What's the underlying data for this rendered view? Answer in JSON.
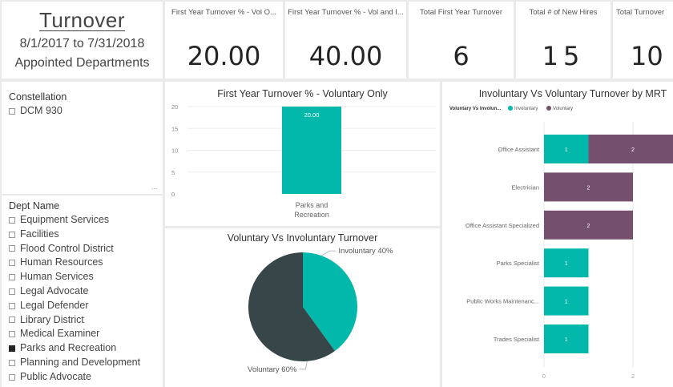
{
  "header": {
    "title": "Turnover",
    "date_range": "8/1/2017 to 7/31/2018",
    "scope": "Appointed Departments"
  },
  "cards": [
    {
      "label": "First Year Turnover % - Vol O...",
      "value": "20.00"
    },
    {
      "label": "First Year Turnover % - Vol and I...",
      "value": "40.00"
    },
    {
      "label": "Total First Year Turnover",
      "value": "6"
    },
    {
      "label": "Total # of New Hires",
      "value": "15"
    },
    {
      "label": "Total Turnover",
      "value": "10"
    }
  ],
  "constellation": {
    "title": "Constellation",
    "items": [
      {
        "label": "DCM 930",
        "checked": false
      }
    ],
    "more": "..."
  },
  "dept": {
    "title": "Dept Name",
    "items": [
      {
        "label": "Equipment Services",
        "checked": false
      },
      {
        "label": "Facilities",
        "checked": false
      },
      {
        "label": "Flood Control District",
        "checked": false
      },
      {
        "label": "Human Resources",
        "checked": false
      },
      {
        "label": "Human Services",
        "checked": false
      },
      {
        "label": "Legal Advocate",
        "checked": false
      },
      {
        "label": "Legal Defender",
        "checked": false
      },
      {
        "label": "Library District",
        "checked": false
      },
      {
        "label": "Medical Examiner",
        "checked": false
      },
      {
        "label": "Parks and Recreation",
        "checked": true
      },
      {
        "label": "Planning and Development",
        "checked": false
      },
      {
        "label": "Public Advocate",
        "checked": false
      }
    ]
  },
  "colors": {
    "teal": "#01b8aa",
    "plum": "#744f6e",
    "dark": "#374649"
  },
  "chart_data": [
    {
      "type": "bar",
      "title": "First Year Turnover % - Voluntary Only",
      "categories": [
        "Parks and Recreation"
      ],
      "category_lines": [
        [
          "Parks and",
          "Recreation"
        ]
      ],
      "values": [
        20.0
      ],
      "data_labels": [
        "20.00"
      ],
      "ylim": [
        0,
        20
      ],
      "yticks": [
        0,
        5,
        10,
        15,
        20
      ]
    },
    {
      "type": "pie",
      "title": "Voluntary Vs Involuntary Turnover",
      "slices": [
        {
          "name": "Involuntary",
          "value": 40,
          "label": "Involuntary 40%"
        },
        {
          "name": "Voluntary",
          "value": 60,
          "label": "Voluntary 60%"
        }
      ]
    },
    {
      "type": "bar",
      "orientation": "horizontal",
      "stacked": true,
      "title": "Involuntary Vs Voluntary Turnover by MRT",
      "legend_title": "Voluntary Vs Involun...",
      "legend": [
        "Involuntary",
        "Voluntary"
      ],
      "categories": [
        "Office Assistant",
        "Electrician",
        "Office Assistant Specialized",
        "Parks Specialist",
        "Public Works Maintenanc...",
        "Trades Specialist"
      ],
      "series": [
        {
          "name": "Involuntary",
          "values": [
            1,
            0,
            0,
            1,
            1,
            1
          ]
        },
        {
          "name": "Voluntary",
          "values": [
            2,
            2,
            2,
            0,
            0,
            0
          ]
        }
      ],
      "xticks": [
        0,
        2
      ]
    }
  ]
}
